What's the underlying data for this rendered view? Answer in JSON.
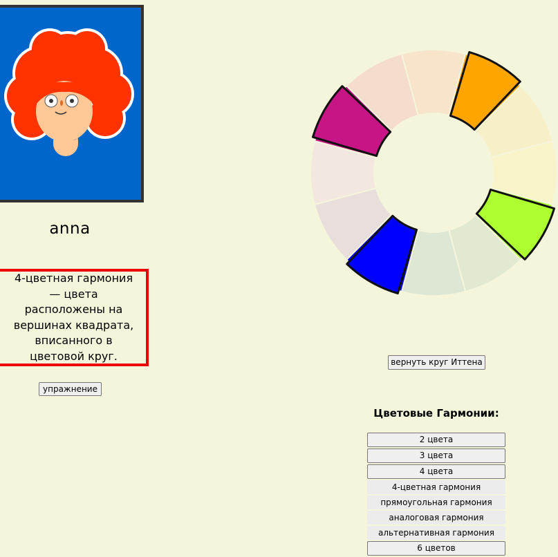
{
  "profile": {
    "username": "anna",
    "description": "4-цветная гармония — цвета расположены на вершинах квадрата, вписанного в цветовой круг."
  },
  "buttons": {
    "exercise": "упражнение",
    "return_wheel": "вернуть круг Иттена"
  },
  "harmonies": {
    "title": "Цветовые Гармонии:",
    "items": [
      {
        "label": "2 цвета",
        "kind": "button"
      },
      {
        "label": "3 цвета",
        "kind": "button"
      },
      {
        "label": "4 цвета",
        "kind": "button"
      },
      {
        "label": "4-цветная гармония",
        "kind": "sub"
      },
      {
        "label": "прямоугольная гармония",
        "kind": "sub"
      },
      {
        "label": "аналоговая гармония",
        "kind": "sub"
      },
      {
        "label": "альтернативная гармония",
        "kind": "sub"
      },
      {
        "label": "6 цветов",
        "kind": "button"
      }
    ]
  },
  "colors": {
    "background": "#f5f5dc",
    "avatar_bg": "#0066cc",
    "hair": "#ff3300",
    "desc_border": "#ee0000"
  },
  "color_wheel": {
    "segments": [
      {
        "name": "yellow-orange",
        "color": "#f7e4ca",
        "selected": false
      },
      {
        "name": "orange",
        "color": "#ffa500",
        "selected": true
      },
      {
        "name": "orange-red",
        "color": "#f7efc8",
        "selected": false
      },
      {
        "name": "yellow",
        "color": "#f8f3c8",
        "selected": false
      },
      {
        "name": "yellow-green",
        "color": "#adff2f",
        "selected": true
      },
      {
        "name": "green",
        "color": "#e1ead1",
        "selected": false
      },
      {
        "name": "blue-green",
        "color": "#dde7d4",
        "selected": false
      },
      {
        "name": "blue",
        "color": "#0000ff",
        "selected": true
      },
      {
        "name": "blue-violet",
        "color": "#e8dfdc",
        "selected": false
      },
      {
        "name": "violet",
        "color": "#f3e8df",
        "selected": false
      },
      {
        "name": "red-violet",
        "color": "#c71585",
        "selected": true
      },
      {
        "name": "red",
        "color": "#f5dccb",
        "selected": false
      }
    ]
  }
}
